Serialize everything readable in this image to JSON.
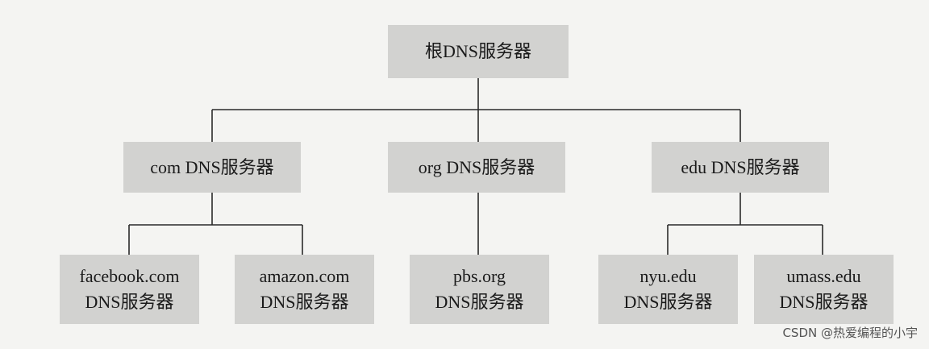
{
  "diagram": {
    "root": {
      "label": "根DNS服务器"
    },
    "tld": [
      {
        "label": "com DNS服务器"
      },
      {
        "label": "org DNS服务器"
      },
      {
        "label": "edu DNS服务器"
      }
    ],
    "authoritative": [
      {
        "line1": "facebook.com",
        "line2": "DNS服务器"
      },
      {
        "line1": "amazon.com",
        "line2": "DNS服务器"
      },
      {
        "line1": "pbs.org",
        "line2": "DNS服务器"
      },
      {
        "line1": "nyu.edu",
        "line2": "DNS服务器"
      },
      {
        "line1": "umass.edu",
        "line2": "DNS服务器"
      }
    ]
  },
  "watermark": {
    "text": "CSDN @热爱编程的小宇"
  },
  "colors": {
    "background": "#f4f4f2",
    "box_fill": "#d2d2d0",
    "line": "#2a2a2a",
    "text": "#1a1a1a"
  }
}
